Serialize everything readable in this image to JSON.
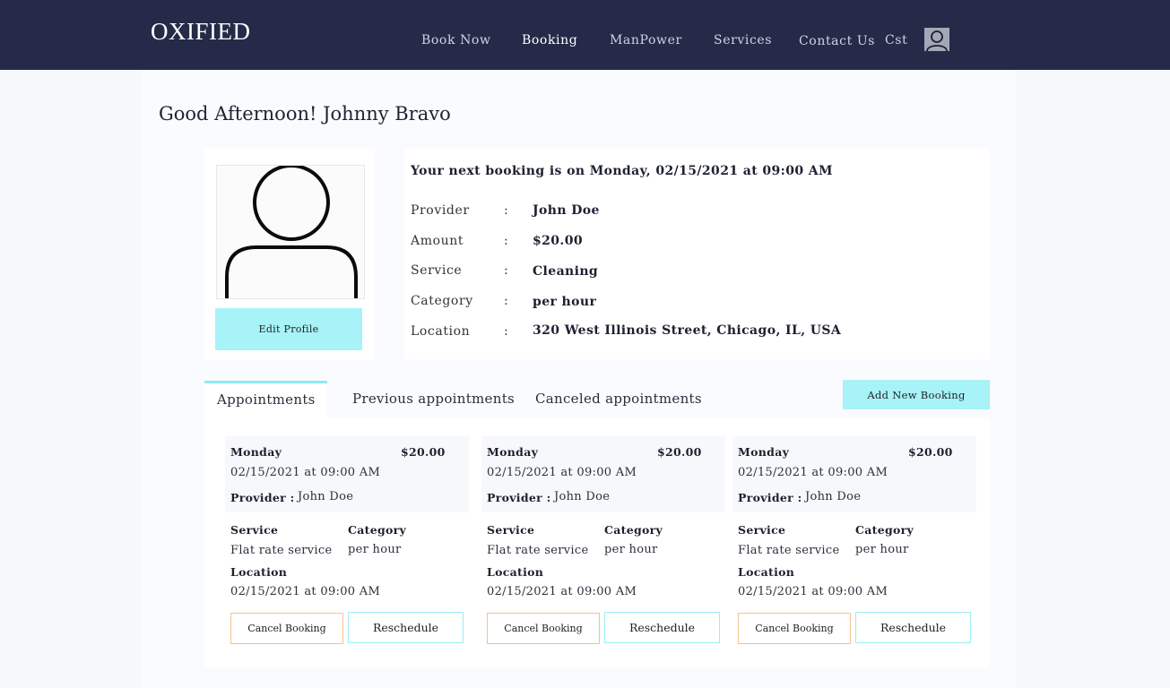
{
  "nav": {
    "logo": "OXIFIED",
    "links": [
      "Book Now",
      "Booking",
      "ManPower",
      "Services",
      "Contact Us"
    ],
    "user_short": "Cst",
    "avatar_icon": "user-avatar-icon"
  },
  "greeting": "Good Afternoon! Johnny Bravo",
  "profile": {
    "avatar_icon": "user-placeholder-icon",
    "edit_label": "Edit Profile"
  },
  "next_booking": {
    "title": "Your next booking is on Monday, 02/15/2021 at 09:00 AM",
    "rows": [
      {
        "label": "Provider",
        "value": "John Doe"
      },
      {
        "label": "Amount",
        "value": "$20.00"
      },
      {
        "label": "Service",
        "value": "Cleaning"
      },
      {
        "label": "Category",
        "value": "per hour"
      },
      {
        "label": "Location",
        "value": "320 West Illinois Street, Chicago, IL, USA"
      }
    ],
    "separator": ":"
  },
  "tabs": [
    "Appointments",
    "Previous appointments",
    "Canceled appointments"
  ],
  "add_booking_label": "Add New Booking",
  "appointments": [
    {
      "day": "Monday",
      "price": "$20.00",
      "datetime": "02/15/2021 at 09:00 AM",
      "provider_label": "Provider :",
      "provider": "John Doe",
      "service_label": "Service",
      "service": "Flat rate service",
      "category_label": "Category",
      "category": "per hour",
      "location_label": "Location",
      "location": "02/15/2021 at 09:00 AM",
      "cancel_label": "Cancel Booking",
      "reschedule_label": "Reschedule"
    },
    {
      "day": "Monday",
      "price": "$20.00",
      "datetime": "02/15/2021 at 09:00 AM",
      "provider_label": "Provider :",
      "provider": "John Doe",
      "service_label": "Service",
      "service": "Flat rate service",
      "category_label": "Category",
      "category": "per hour",
      "location_label": "Location",
      "location": "02/15/2021 at 09:00 AM",
      "cancel_label": "Cancel Booking",
      "reschedule_label": "Reschedule"
    },
    {
      "day": "Monday",
      "price": "$20.00",
      "datetime": "02/15/2021 at 09:00 AM",
      "provider_label": "Provider :",
      "provider": "John Doe",
      "service_label": "Service",
      "service": "Flat rate service",
      "category_label": "Category",
      "category": "per hour",
      "location_label": "Location",
      "location": "02/15/2021 at 09:00 AM",
      "cancel_label": "Cancel Booking",
      "reschedule_label": "Reschedule"
    }
  ],
  "colors": {
    "nav_bg": "#252a48",
    "accent_cyan": "#a7f3f7",
    "cancel_border": "#f6c28f",
    "reschedule_border": "#9beef2"
  }
}
